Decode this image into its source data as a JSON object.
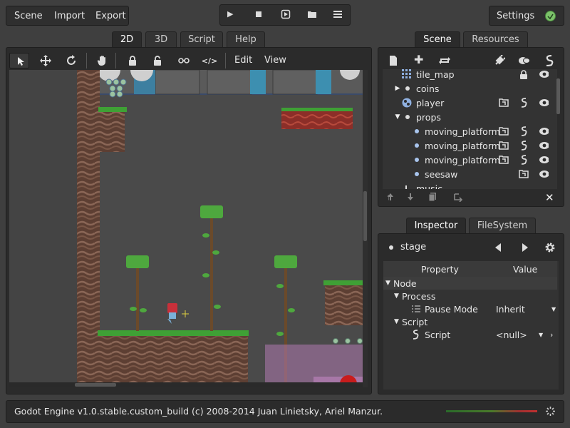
{
  "menu": {
    "scene": "Scene",
    "import": "Import",
    "export": "Export"
  },
  "settings": {
    "label": "Settings"
  },
  "play_controls": [
    {
      "name": "play-icon",
      "glyph": "▶"
    },
    {
      "name": "stop-icon",
      "glyph": "■"
    },
    {
      "name": "play-scene-icon",
      "glyph": "▶"
    },
    {
      "name": "open-scene-icon",
      "glyph": "▭"
    },
    {
      "name": "list-icon",
      "glyph": "☰"
    }
  ],
  "editor_tabs": [
    "2D",
    "3D",
    "Script",
    "Help"
  ],
  "viewport_toolbar": {
    "edit": "Edit",
    "view": "View"
  },
  "scene_dock": {
    "tabs": [
      "Scene",
      "Resources"
    ],
    "tree": [
      {
        "label": "tile_map"
      },
      {
        "label": "coins"
      },
      {
        "label": "player"
      },
      {
        "label": "props"
      },
      {
        "label": "moving_platform"
      },
      {
        "label": "moving_platform"
      },
      {
        "label": "moving_platform"
      },
      {
        "label": "seesaw"
      },
      {
        "label": "music"
      }
    ]
  },
  "inspector_dock": {
    "tabs": [
      "Inspector",
      "FileSystem"
    ],
    "node_name": "stage",
    "header": {
      "property": "Property",
      "value": "Value"
    },
    "sections": {
      "node": "Node",
      "process": "Process",
      "pause_mode_label": "Pause Mode",
      "pause_mode_value": "Inherit",
      "script_section": "Script",
      "script_label": "Script",
      "script_value": "<null>"
    }
  },
  "status_bar": {
    "text": "Godot Engine v1.0.stable.custom_build (c) 2008-2014 Juan Linietsky, Ariel Manzur."
  },
  "colors": {
    "accent": "#4d9c5c",
    "ground": "#6b4a3c",
    "grass": "#3fa035",
    "selection": "#a86aa8"
  }
}
